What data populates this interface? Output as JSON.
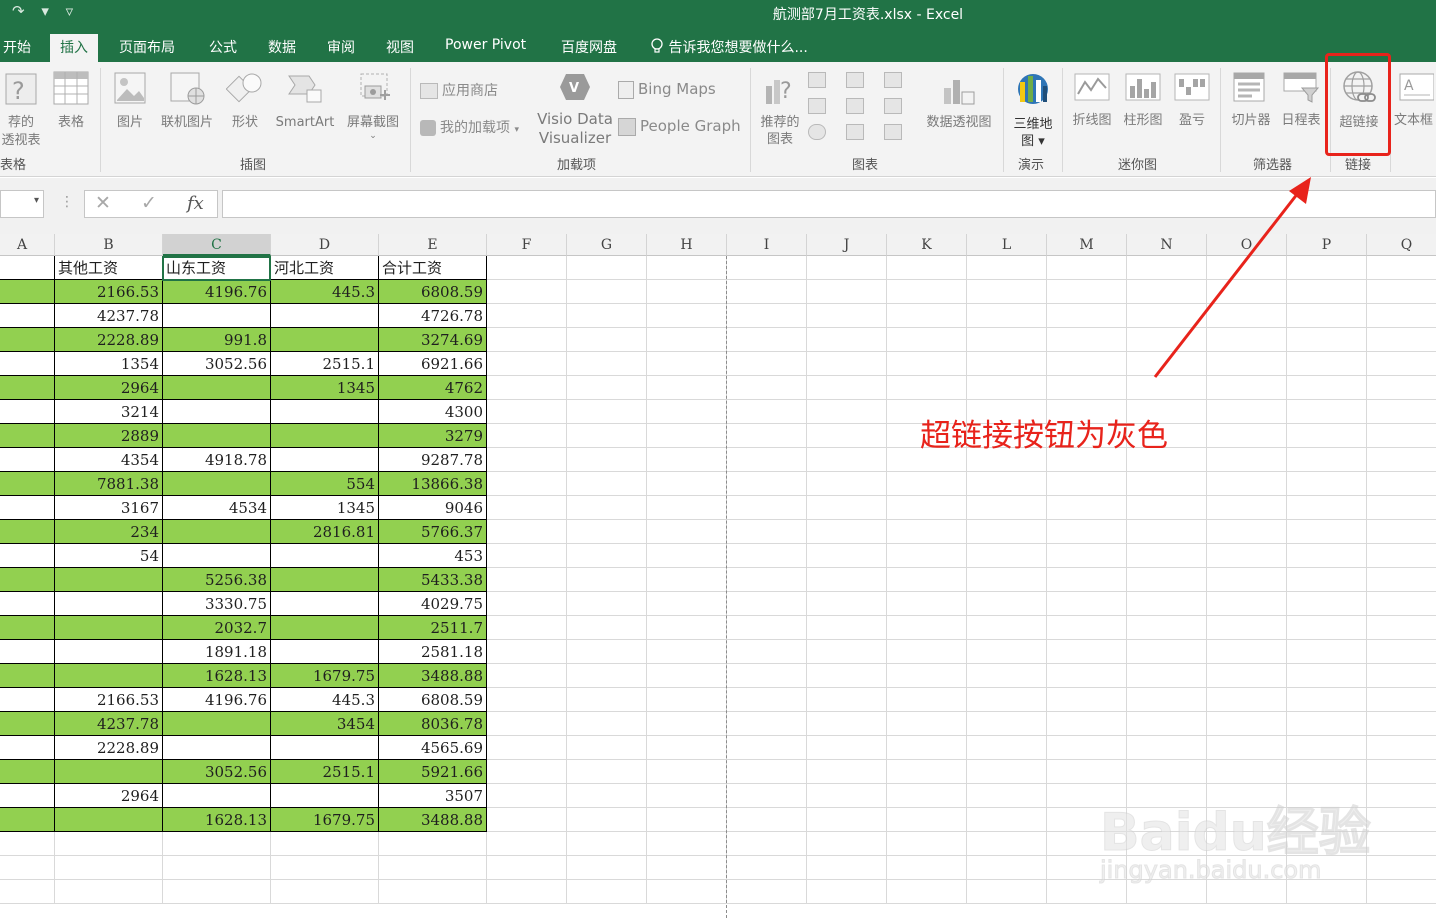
{
  "window": {
    "title": "航测部7月工资表.xlsx - Excel",
    "quick_access_icons": [
      "redo-icon",
      "dropdown-icon"
    ]
  },
  "tabs": [
    {
      "label": "开始",
      "active": false
    },
    {
      "label": "插入",
      "active": true
    },
    {
      "label": "页面布局",
      "active": false
    },
    {
      "label": "公式",
      "active": false
    },
    {
      "label": "数据",
      "active": false
    },
    {
      "label": "审阅",
      "active": false
    },
    {
      "label": "视图",
      "active": false
    },
    {
      "label": "Power Pivot",
      "active": false
    },
    {
      "label": "百度网盘",
      "active": false
    }
  ],
  "tell_me": {
    "label": "告诉我您想要做什么...",
    "icon": "lightbulb-icon"
  },
  "ribbon": {
    "tables": {
      "pivot_label": "荐的\n透视表",
      "table_label": "表格",
      "group_label": "表格"
    },
    "illustrations": {
      "picture": "图片",
      "online_picture": "联机图片",
      "shapes": "形状",
      "smartart": "SmartArt",
      "screenshot": "屏幕截图",
      "group_label": "插图"
    },
    "addins": {
      "store": "应用商店",
      "my_addins": "我的加载项",
      "visio_line1": "Visio Data",
      "visio_line2": "Visualizer",
      "bing_maps": "Bing Maps",
      "people_graph": "People Graph",
      "group_label": "加载项"
    },
    "charts": {
      "recommended_line1": "推荐的",
      "recommended_line2": "图表",
      "pivot_chart": "数据透视图",
      "group_label": "图表"
    },
    "tours": {
      "map3d_line1": "三维地",
      "map3d_line2": "图",
      "group_label": "演示"
    },
    "sparklines": {
      "line": "折线图",
      "column": "柱形图",
      "winloss": "盈亏",
      "group_label": "迷你图"
    },
    "filters": {
      "slicer": "切片器",
      "timeline": "日程表",
      "group_label": "筛选器"
    },
    "links": {
      "hyperlink": "超链接",
      "group_label": "链接"
    },
    "text": {
      "textbox": "文本框"
    }
  },
  "formula_bar": {
    "fx": "fx",
    "cancel_icon": "cancel-icon",
    "enter_icon": "check-icon"
  },
  "sheet": {
    "columns": [
      "A",
      "B",
      "C",
      "D",
      "E",
      "F",
      "G",
      "H",
      "I",
      "J",
      "K",
      "L",
      "M",
      "N",
      "O",
      "P",
      "Q"
    ],
    "selected_column": "C",
    "header_row": {
      "A": "",
      "B": "其他工资",
      "C": "山东工资",
      "D": "河北工资",
      "E": "合计工资"
    },
    "rows": [
      {
        "A": "",
        "B": "2166.53",
        "C": "4196.76",
        "D": "445.3",
        "E": "6808.59",
        "fill": "green"
      },
      {
        "A": "",
        "B": "4237.78",
        "C": "",
        "D": "",
        "E": "4726.78",
        "fill": "white"
      },
      {
        "A": "",
        "B": "2228.89",
        "C": "991.8",
        "D": "",
        "E": "3274.69",
        "fill": "green"
      },
      {
        "A": "",
        "B": "1354",
        "C": "3052.56",
        "D": "2515.1",
        "E": "6921.66",
        "fill": "white"
      },
      {
        "A": "",
        "B": "2964",
        "C": "",
        "D": "1345",
        "E": "4762",
        "fill": "green"
      },
      {
        "A": "",
        "B": "3214",
        "C": "",
        "D": "",
        "E": "4300",
        "fill": "white"
      },
      {
        "A": "",
        "B": "2889",
        "C": "",
        "D": "",
        "E": "3279",
        "fill": "green"
      },
      {
        "A": "",
        "B": "4354",
        "C": "4918.78",
        "D": "",
        "E": "9287.78",
        "fill": "white"
      },
      {
        "A": "",
        "B": "7881.38",
        "C": "",
        "D": "554",
        "E": "13866.38",
        "fill": "green"
      },
      {
        "A": "",
        "B": "3167",
        "C": "4534",
        "D": "1345",
        "E": "9046",
        "fill": "white"
      },
      {
        "A": "",
        "B": "234",
        "C": "",
        "D": "2816.81",
        "E": "5766.37",
        "fill": "green"
      },
      {
        "A": "",
        "B": "54",
        "C": "",
        "D": "",
        "E": "453",
        "fill": "white"
      },
      {
        "A": "]",
        "B": "",
        "C": "5256.38",
        "D": "",
        "E": "5433.38",
        "fill": "green"
      },
      {
        "A": "",
        "B": "",
        "C": "3330.75",
        "D": "",
        "E": "4029.75",
        "fill": "white"
      },
      {
        "A": "",
        "B": "",
        "C": "2032.7",
        "D": "",
        "E": "2511.7",
        "fill": "green"
      },
      {
        "A": "",
        "B": "",
        "C": "1891.18",
        "D": "",
        "E": "2581.18",
        "fill": "white"
      },
      {
        "A": "",
        "B": "",
        "C": "1628.13",
        "D": "1679.75",
        "E": "3488.88",
        "fill": "green"
      },
      {
        "A": "",
        "B": "2166.53",
        "C": "4196.76",
        "D": "445.3",
        "E": "6808.59",
        "fill": "white"
      },
      {
        "A": "",
        "B": "4237.78",
        "C": "",
        "D": "3454",
        "E": "8036.78",
        "fill": "green"
      },
      {
        "A": "",
        "B": "2228.89",
        "C": "",
        "D": "",
        "E": "4565.69",
        "fill": "white"
      },
      {
        "A": "",
        "B": "",
        "C": "3052.56",
        "D": "2515.1",
        "E": "5921.66",
        "fill": "green"
      },
      {
        "A": "",
        "B": "2964",
        "C": "",
        "D": "",
        "E": "3507",
        "fill": "white"
      },
      {
        "A": "",
        "B": "",
        "C": "1628.13",
        "D": "1679.75",
        "E": "3488.88",
        "fill": "green"
      }
    ],
    "colors": {
      "row_fill_green": "#92d050",
      "accent": "#217346"
    }
  },
  "annotation": {
    "text": "超链接按钮为灰色",
    "color": "#e8231b"
  },
  "watermark": {
    "line1": "Baidu经验",
    "line2": "jingyan.baidu.com"
  }
}
